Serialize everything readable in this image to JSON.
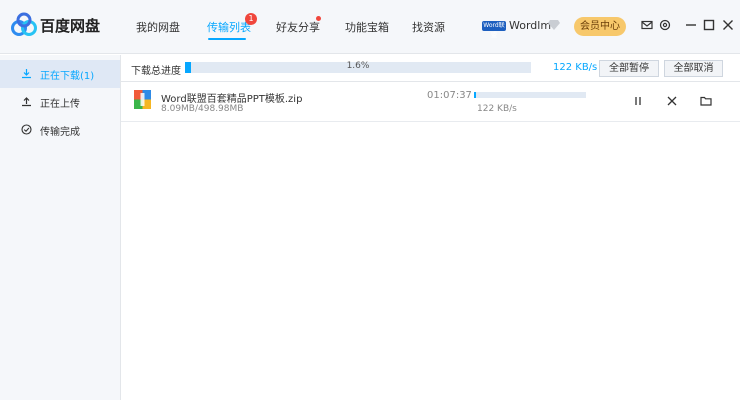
{
  "app": {
    "name": "百度网盘"
  },
  "nav": {
    "tabs": [
      {
        "label": "我的网盘"
      },
      {
        "label": "传输列表",
        "active": true,
        "badge": "1"
      },
      {
        "label": "好友分享"
      },
      {
        "label": "功能宝箱"
      },
      {
        "label": "找资源"
      }
    ]
  },
  "user": {
    "avatar_text": "Word联盟",
    "name": "Wordlm",
    "vip_button": "会员中心"
  },
  "icons": {
    "titlebar": [
      "mail-icon",
      "settings-icon",
      "minimize-icon",
      "maximize-icon",
      "close-icon"
    ]
  },
  "sidebar": {
    "items": [
      {
        "label": "正在下载(1)",
        "icon": "download-icon",
        "active": true
      },
      {
        "label": "正在上传",
        "icon": "upload-icon"
      },
      {
        "label": "传输完成",
        "icon": "check-circle-icon"
      }
    ]
  },
  "toolbar": {
    "total_label": "下载总进度",
    "total_percent": "1.6%",
    "total_progress": 0.016,
    "total_speed": "122 KB/s",
    "pause_all": "全部暂停",
    "cancel_all": "全部取消"
  },
  "downloads": [
    {
      "name": "Word联盟百套精品PPT模板.zip",
      "size": "8.09MB/498.98MB",
      "remaining": "01:07:37",
      "progress": 0.016,
      "speed": "122 KB/s"
    }
  ],
  "colors": {
    "accent": "#06a7ff",
    "badge": "#f0463c",
    "vip": "#f7c86b",
    "sidebar_bg": "#f5f7fa"
  }
}
